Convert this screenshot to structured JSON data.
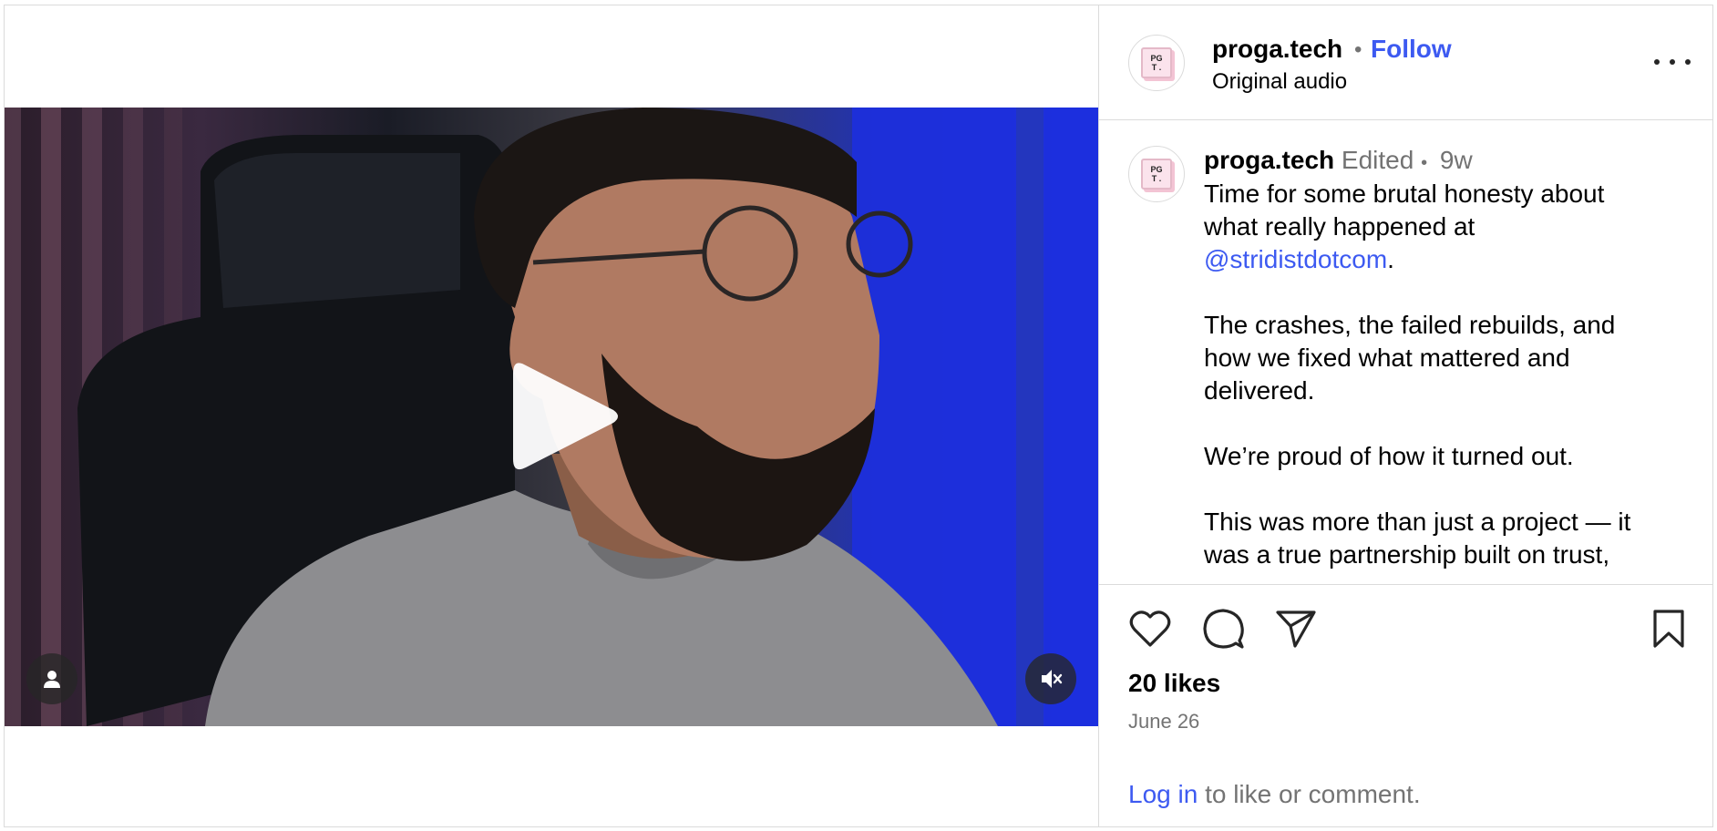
{
  "header": {
    "username": "proga.tech",
    "separator": "•",
    "follow_label": "Follow",
    "audio_label": "Original audio",
    "avatar_text": "PG\nT ."
  },
  "caption": {
    "username": "proga.tech",
    "edited_label": "Edited",
    "separator": "•",
    "age": "9w",
    "line1": "Time for some brutal honesty about what really happened at",
    "mention": "@stridistdotcom",
    "line1_end": ".",
    "para2": "The crashes, the failed rebuilds, and how we fixed what mattered and delivered.",
    "para3": "We’re proud of how it turned out.",
    "para4": "This was more than just a project — it was a true partnership built on trust,"
  },
  "video": {
    "play_icon": "play-icon",
    "user_icon": "user-icon",
    "mute_icon": "muted-speaker-icon",
    "muted": true
  },
  "actions": {
    "like_icon": "heart-icon",
    "comment_icon": "comment-icon",
    "share_icon": "paper-plane-icon",
    "save_icon": "bookmark-icon"
  },
  "stats": {
    "likes": "20 likes",
    "date": "June 26"
  },
  "footer": {
    "login_link": "Log in",
    "login_rest": " to like or comment."
  },
  "colors": {
    "link": "#3d5af1",
    "secondary_text": "#737373",
    "border": "#dbdbdb"
  }
}
